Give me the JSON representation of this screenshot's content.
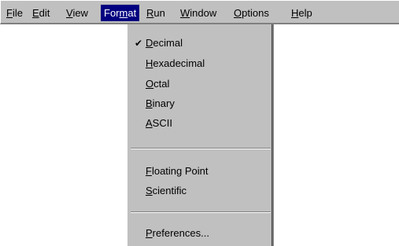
{
  "menubar": {
    "items": [
      {
        "pre": "",
        "key": "F",
        "post": "ile"
      },
      {
        "pre": "",
        "key": "E",
        "post": "dit"
      },
      {
        "pre": "",
        "key": "V",
        "post": "iew"
      },
      {
        "pre": "For",
        "key": "m",
        "post": "at"
      },
      {
        "pre": "",
        "key": "R",
        "post": "un"
      },
      {
        "pre": "",
        "key": "W",
        "post": "indow"
      },
      {
        "pre": "",
        "key": "O",
        "post": "ptions"
      },
      {
        "pre": "",
        "key": "H",
        "post": "elp"
      }
    ],
    "active_index": 3
  },
  "format_menu": {
    "check_glyph": "✔",
    "checked_item": "decimal",
    "items": {
      "decimal": {
        "pre": "",
        "key": "D",
        "post": "ecimal"
      },
      "hexadecimal": {
        "pre": "",
        "key": "H",
        "post": "exadecimal"
      },
      "octal": {
        "pre": "",
        "key": "O",
        "post": "ctal"
      },
      "binary": {
        "pre": "",
        "key": "B",
        "post": "inary"
      },
      "ascii": {
        "pre": "",
        "key": "A",
        "post": "SCII"
      },
      "floating_point": {
        "pre": "",
        "key": "F",
        "post": "loating Point"
      },
      "scientific": {
        "pre": "",
        "key": "S",
        "post": "cientific"
      },
      "preferences": {
        "pre": "",
        "key": "P",
        "post": "references..."
      }
    }
  },
  "colors": {
    "menu_background": "#c0c0c0",
    "highlight_background": "#000080",
    "highlight_text": "#ffffff"
  }
}
